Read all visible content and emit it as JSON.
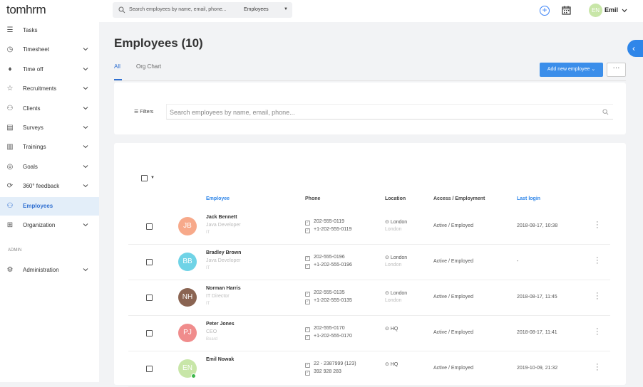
{
  "header": {
    "logo": "tomhrm",
    "search_placeholder": "Search employees by name, email, phone...",
    "search_scope": "Employees",
    "user_initials": "EN",
    "user_name": "Emil"
  },
  "sidebar": {
    "items": [
      {
        "label": "Tasks",
        "icon": "list-check-icon",
        "has_submenu": false
      },
      {
        "label": "Timesheet",
        "icon": "clock-icon",
        "has_submenu": true
      },
      {
        "label": "Time off",
        "icon": "pin-icon",
        "has_submenu": true
      },
      {
        "label": "Recruitments",
        "icon": "star-icon",
        "has_submenu": true
      },
      {
        "label": "Clients",
        "icon": "clients-icon",
        "has_submenu": true
      },
      {
        "label": "Surveys",
        "icon": "survey-icon",
        "has_submenu": true
      },
      {
        "label": "Trainings",
        "icon": "training-icon",
        "has_submenu": true
      },
      {
        "label": "Goals",
        "icon": "target-icon",
        "has_submenu": true
      },
      {
        "label": "360° feedback",
        "icon": "feedback-icon",
        "has_submenu": true
      },
      {
        "label": "Employees",
        "icon": "people-icon",
        "has_submenu": false,
        "active": true
      },
      {
        "label": "Organization",
        "icon": "org-chart-icon",
        "has_submenu": true
      }
    ],
    "admin_section_label": "ADMIN",
    "admin_items": [
      {
        "label": "Administration",
        "icon": "gear-icon",
        "has_submenu": true
      }
    ]
  },
  "main": {
    "title": "Employees (10)",
    "tabs": [
      {
        "label": "All",
        "active": true
      },
      {
        "label": "Org Chart",
        "active": false
      }
    ],
    "add_button_label": "Add new employee",
    "more_button_label": "···",
    "filters_label": "Filters",
    "filter_search_placeholder": "Search employees by name, email, phone..."
  },
  "table": {
    "columns": [
      "Employee",
      "Phone",
      "Location",
      "Access / Employment",
      "Last login"
    ],
    "rows": [
      {
        "initials": "JB",
        "avatar_color": "#f7a98a",
        "name": "Jack Bennett",
        "title": "Java Developer",
        "dept": "IT",
        "phone1": "202-555-0119",
        "phone2": "+1-202-555-0119",
        "location": "London",
        "location_sub": "London",
        "access": "Active / Employed",
        "last_login": "2018-08-17, 10:38",
        "online": false
      },
      {
        "initials": "BB",
        "avatar_color": "#6fd3e6",
        "name": "Bradley Brown",
        "title": "Java Developer",
        "dept": "IT",
        "phone1": "202-555-0196",
        "phone2": "+1-202-555-0196",
        "location": "London",
        "location_sub": "London",
        "access": "Active / Employed",
        "last_login": "-",
        "online": false
      },
      {
        "initials": "NH",
        "avatar_color": "#8a6452",
        "name": "Norman Harris",
        "title": "IT Director",
        "dept": "IT",
        "phone1": "202-555-0135",
        "phone2": "+1-202-555-0135",
        "location": "London",
        "location_sub": "London",
        "access": "Active / Employed",
        "last_login": "2018-08-17, 11:45",
        "online": false
      },
      {
        "initials": "PJ",
        "avatar_color": "#f08c8c",
        "name": "Peter Jones",
        "title": "CEO",
        "dept": "Board",
        "phone1": "202-555-0170",
        "phone2": "+1-202-555-0170",
        "location": "HQ",
        "location_sub": "",
        "access": "Active / Employed",
        "last_login": "2018-08-17, 11:41",
        "online": false
      },
      {
        "initials": "EN",
        "avatar_color": "#c8e6a8",
        "name": "Emil Nowak",
        "title": "",
        "dept": "",
        "phone1": "22 - 2387999 (123)",
        "phone2": "392 928 283",
        "location": "HQ",
        "location_sub": "",
        "access": "Active / Employed",
        "last_login": "2019-10-09, 21:32",
        "online": true
      }
    ]
  }
}
